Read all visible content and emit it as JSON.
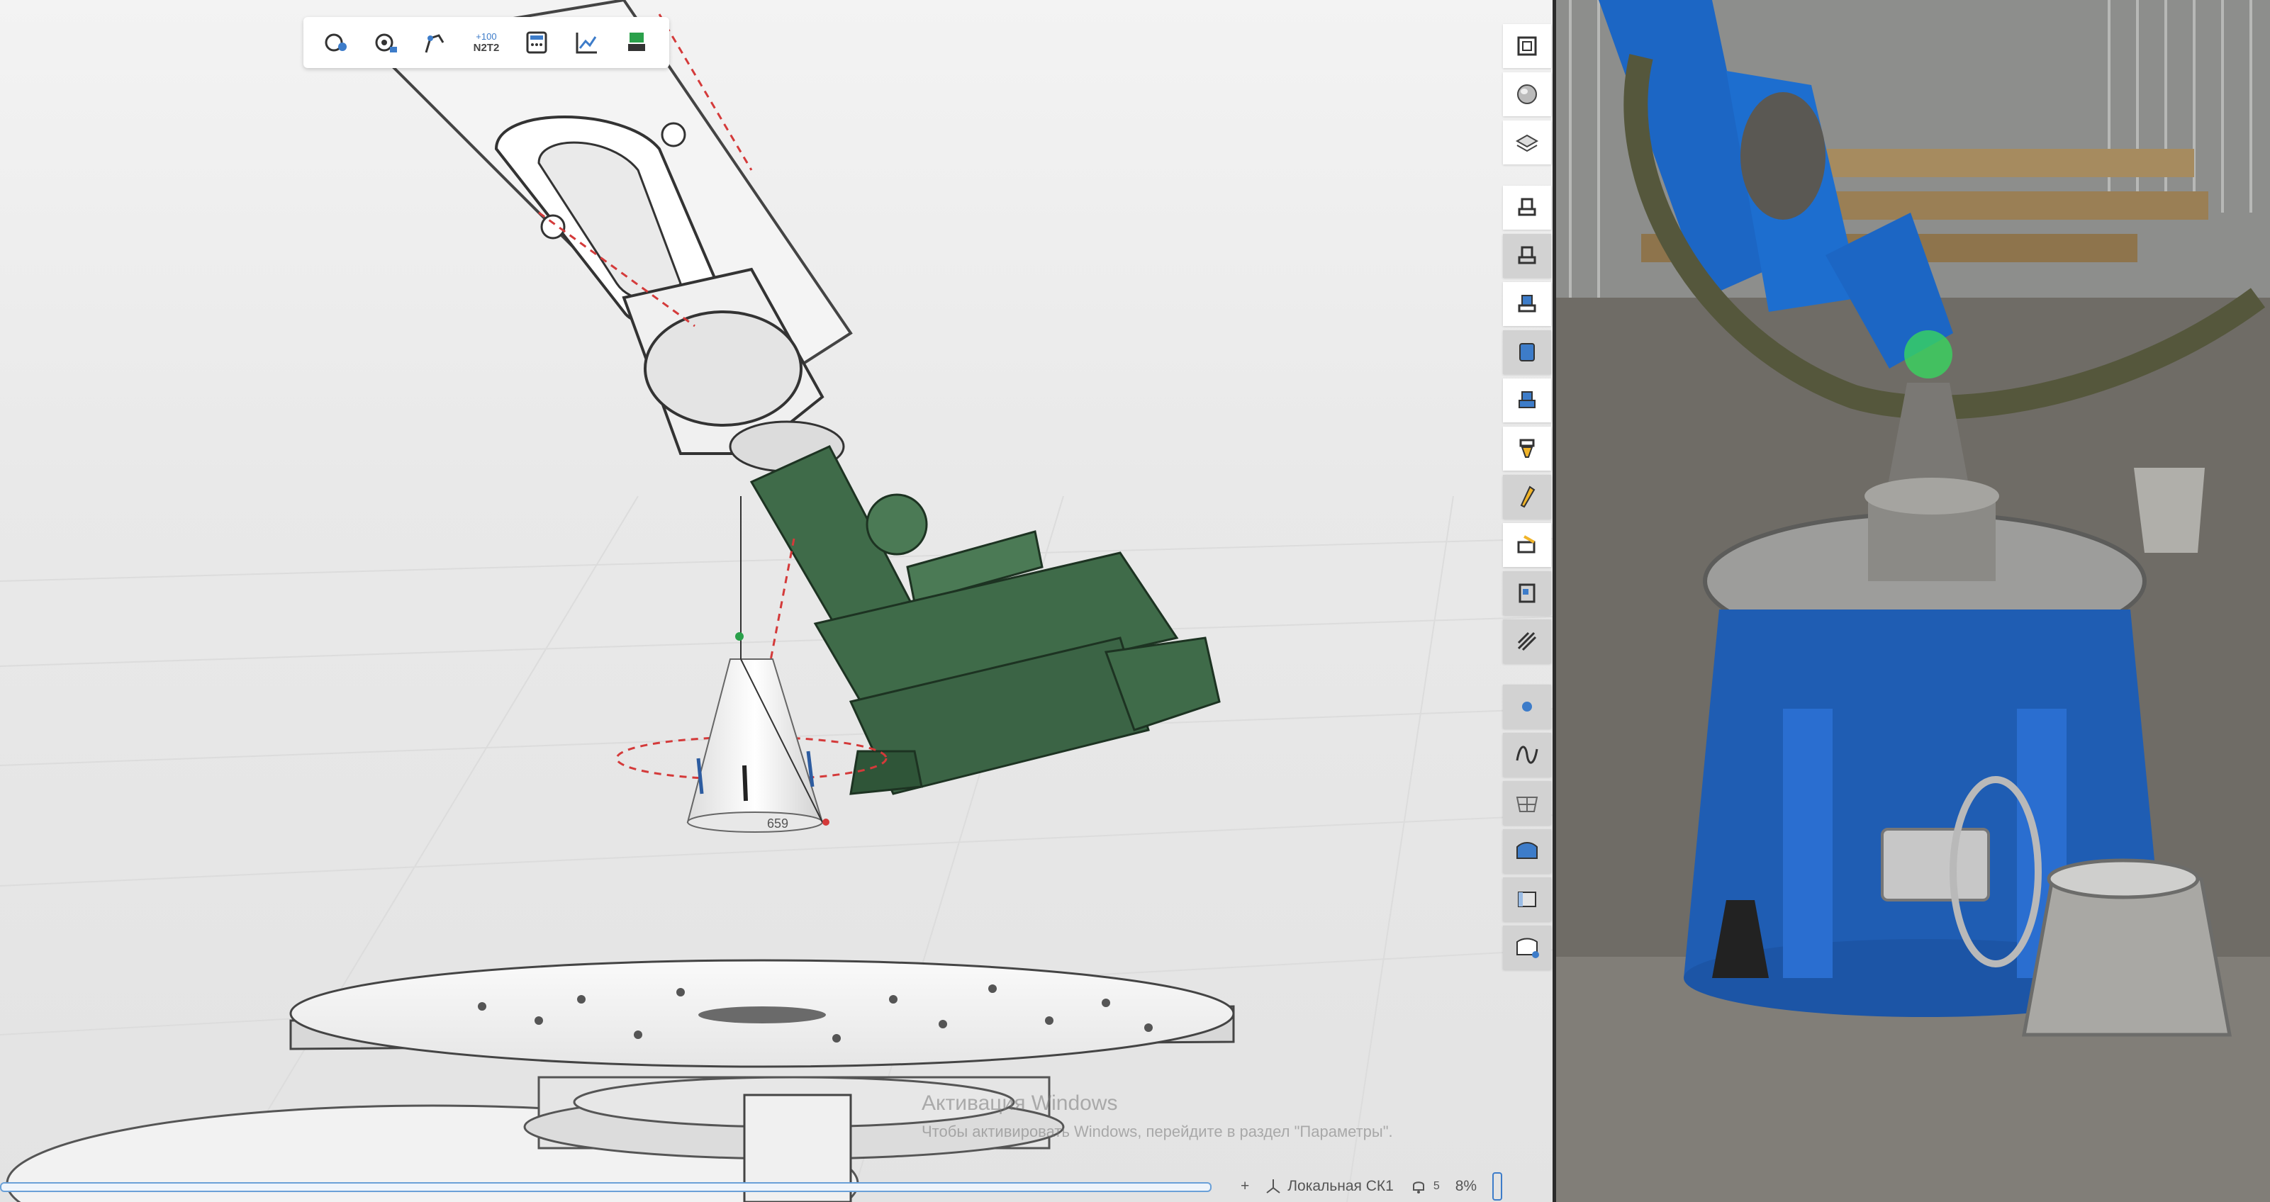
{
  "toolbar": {
    "items": [
      {
        "icon": "tool-add-icon"
      },
      {
        "icon": "tool-settings-icon"
      },
      {
        "icon": "robot-axis-icon"
      },
      {
        "icon": "n2t2-icon",
        "top": "+100",
        "bottom": "N2T2"
      },
      {
        "icon": "calculator-icon"
      },
      {
        "icon": "graph-icon"
      },
      {
        "icon": "layer-icon"
      }
    ]
  },
  "right_toolbar": {
    "items": [
      "fit-view-icon",
      "sphere-view-icon",
      "layers-view-icon",
      "tool-head-icon-1",
      "tool-head-icon-2",
      "tool-head-icon-3",
      "square-blue-icon",
      "tool-head-icon-4",
      "tool-head-icon-5",
      "pen-icon",
      "eraser-icon",
      "measure-icon",
      "hatch-icon",
      "dot-icon",
      "wave-icon",
      "grid-surface-icon",
      "surface-icon",
      "surface-2-icon",
      "surface-3-icon"
    ]
  },
  "scene": {
    "part_label": "659"
  },
  "status_bar": {
    "plus_label": "+",
    "coordinate_system": "Локальная СК1",
    "notifications": "5",
    "zoom": "8%"
  },
  "watermark": {
    "title": "Активация Windows",
    "subtitle": "Чтобы активировать Windows, перейдите в раздел \"Параметры\"."
  },
  "colors": {
    "robot_green": "#3f6b49",
    "robot_blue": "#1c66c4",
    "accent_blue": "#3d7cc9"
  }
}
